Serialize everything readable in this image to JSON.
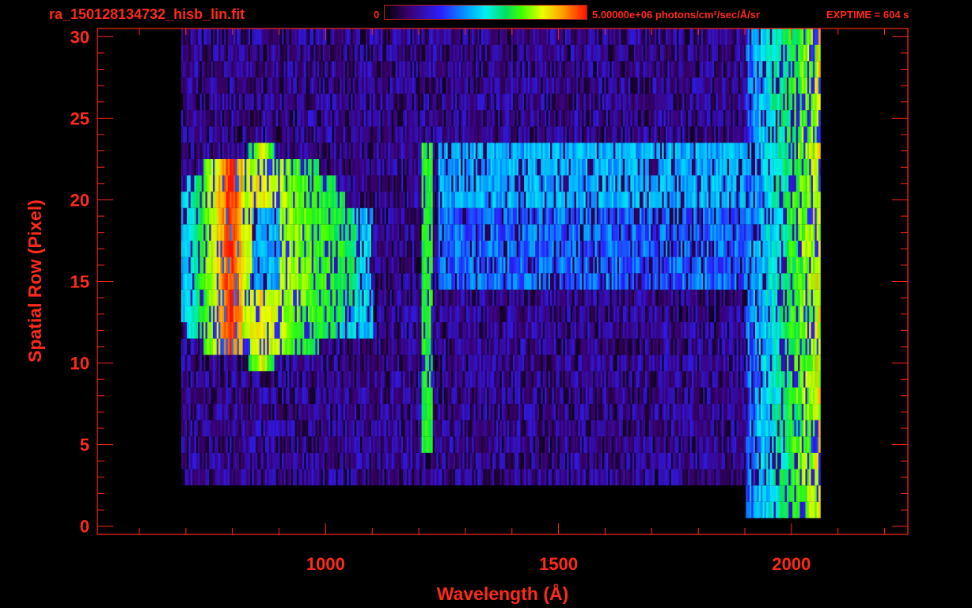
{
  "header": {
    "file_name": "ra_150128134732_hisb_lin.fit",
    "colorbar_min_label": "0",
    "colorbar_max_label": "5.00000e+06 photons/cm²/sec/Å/sr",
    "exposure_label": "EXPTIME = 604 s"
  },
  "colors": {
    "axis": "#ff2a1a",
    "background": "#000000",
    "colormap": [
      "#000000",
      "#3a0070",
      "#2a20ff",
      "#00a8ff",
      "#00f0f0",
      "#00e060",
      "#40ff00",
      "#e8ff00",
      "#ffa000",
      "#ff1000"
    ]
  },
  "chart_data": {
    "type": "heatmap",
    "title": "",
    "xlabel": "Wavelength (Å)",
    "ylabel": "Spatial Row (Pixel)",
    "xlim": [
      510,
      2250
    ],
    "ylim": [
      -0.5,
      30.5
    ],
    "xticks": [
      1000,
      1500,
      2000
    ],
    "yticks": [
      0,
      5,
      10,
      15,
      20,
      25,
      30
    ],
    "x_minor_step": 100,
    "y_minor_step": 1,
    "colorbar_range": [
      0,
      5000000
    ],
    "colorbar_units": "photons/cm²/sec/Å/sr",
    "data_extent": {
      "x": [
        690,
        2060
      ],
      "rows": [
        3,
        30
      ]
    },
    "features": [
      {
        "label": "broad emission at ~750–950 Å",
        "x_range": [
          760,
          960
        ],
        "rows": [
          10,
          23
        ],
        "peak_x": 795,
        "peak_level": 1.0
      },
      {
        "label": "Lyman-alpha line",
        "x_center": 1216,
        "rows": [
          5,
          23
        ],
        "level": 0.62
      },
      {
        "label": "long-wavelength rise",
        "x_range": [
          1900,
          2060
        ],
        "rows": [
          1,
          30
        ],
        "level": 0.55
      }
    ]
  }
}
